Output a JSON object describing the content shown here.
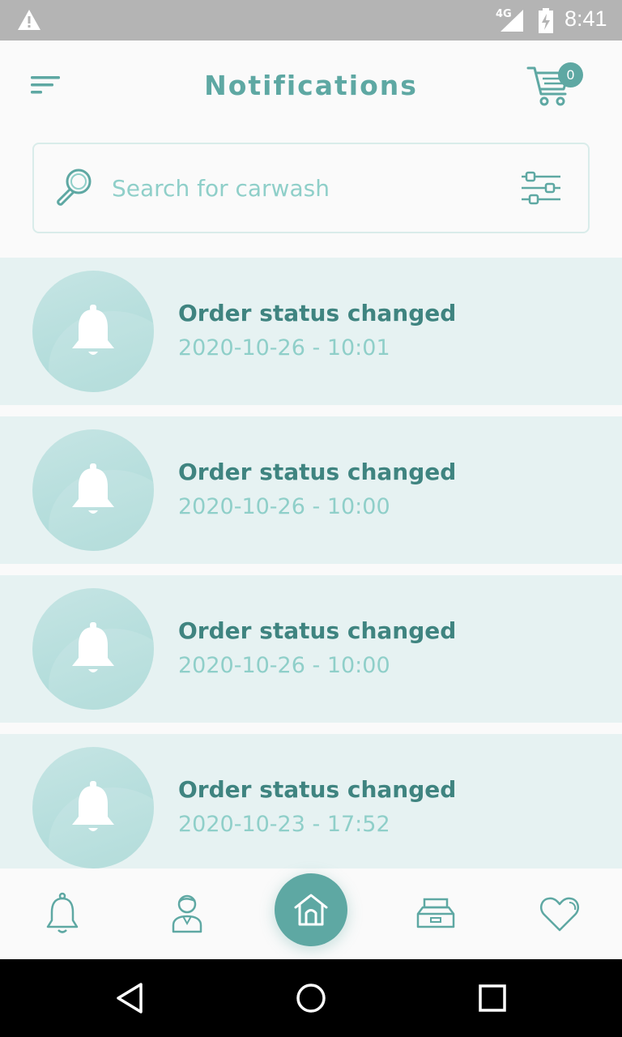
{
  "status_bar": {
    "time": "8:41",
    "network": "4G",
    "icons": [
      "warning-icon",
      "signal-icon",
      "battery-charging-icon"
    ]
  },
  "header": {
    "title": "Notifications",
    "cart_count": "0",
    "icons": [
      "menu-icon",
      "cart-icon"
    ]
  },
  "search": {
    "placeholder": "Search for carwash",
    "icons": [
      "search-icon",
      "filter-icon"
    ]
  },
  "notifications": [
    {
      "title": "Order status changed",
      "date": "2020-10-26 - 10:01"
    },
    {
      "title": "Order status changed",
      "date": "2020-10-26 - 10:00"
    },
    {
      "title": "Order status changed",
      "date": "2020-10-26 - 10:00"
    },
    {
      "title": "Order status changed",
      "date": "2020-10-23 - 17:52"
    }
  ],
  "bottom_nav": {
    "items": [
      "bell-icon",
      "user-icon",
      "home-icon",
      "inbox-icon",
      "heart-icon"
    ],
    "active": "home-icon"
  },
  "system_nav": {
    "items": [
      "back-icon",
      "home-circle-icon",
      "recents-icon"
    ]
  },
  "colors": {
    "accent": "#5ea8a3",
    "accent_light": "#8fcfc9",
    "title_text": "#3f8480",
    "card_bg": "#e6f2f2",
    "status_bar": "#b4b4b4"
  }
}
